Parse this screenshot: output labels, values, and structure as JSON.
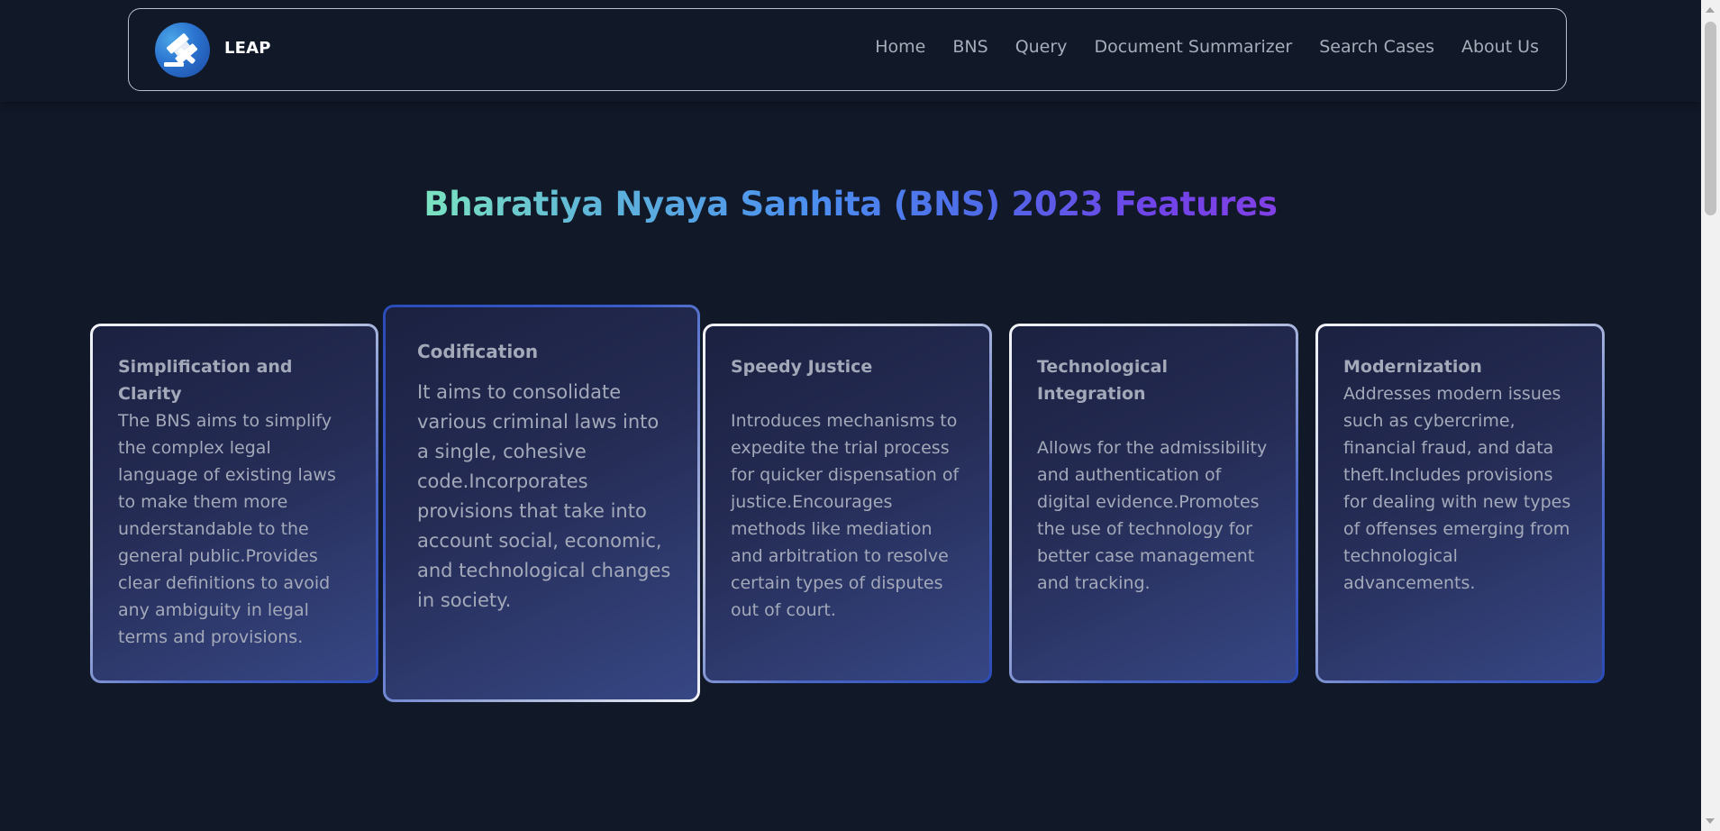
{
  "brand": {
    "name": "LEAP",
    "logo_icon": "gavel-icon"
  },
  "nav": {
    "items": [
      "Home",
      "BNS",
      "Query",
      "Document Summarizer",
      "Search Cases",
      "About Us"
    ]
  },
  "page": {
    "title": "Bharatiya Nyaya Sanhita (BNS) 2023 Features"
  },
  "cards": [
    {
      "title": "Simplification and Clarity",
      "text": "The BNS aims to simplify the complex legal language of existing laws to make them more understandable to the general public.Provides clear definitions to avoid any ambiguity in legal terms and provisions."
    },
    {
      "title": "Codification",
      "text": "It aims to consolidate various criminal laws into a single, cohesive code.Incorporates provisions that take into account social, economic, and technological changes in society."
    },
    {
      "title": "Speedy Justice",
      "text": "Introduces mechanisms to expedite the trial process for quicker dispensation of justice.Encourages methods like mediation and arbitration to resolve certain types of disputes out of court."
    },
    {
      "title": "Technological Integration",
      "text": "Allows for the admissibility and authentication of digital evidence.Promotes the use of technology for better case management and tracking."
    },
    {
      "title": "Modernization",
      "text": "Addresses modern issues such as cybercrime, financial fraud, and data theft.Includes provisions for dealing with new types of offenses emerging from technological advancements."
    }
  ],
  "colors": {
    "background": "#111827",
    "card_text": "#a3a9b9",
    "nav_text": "#a6acb9"
  }
}
